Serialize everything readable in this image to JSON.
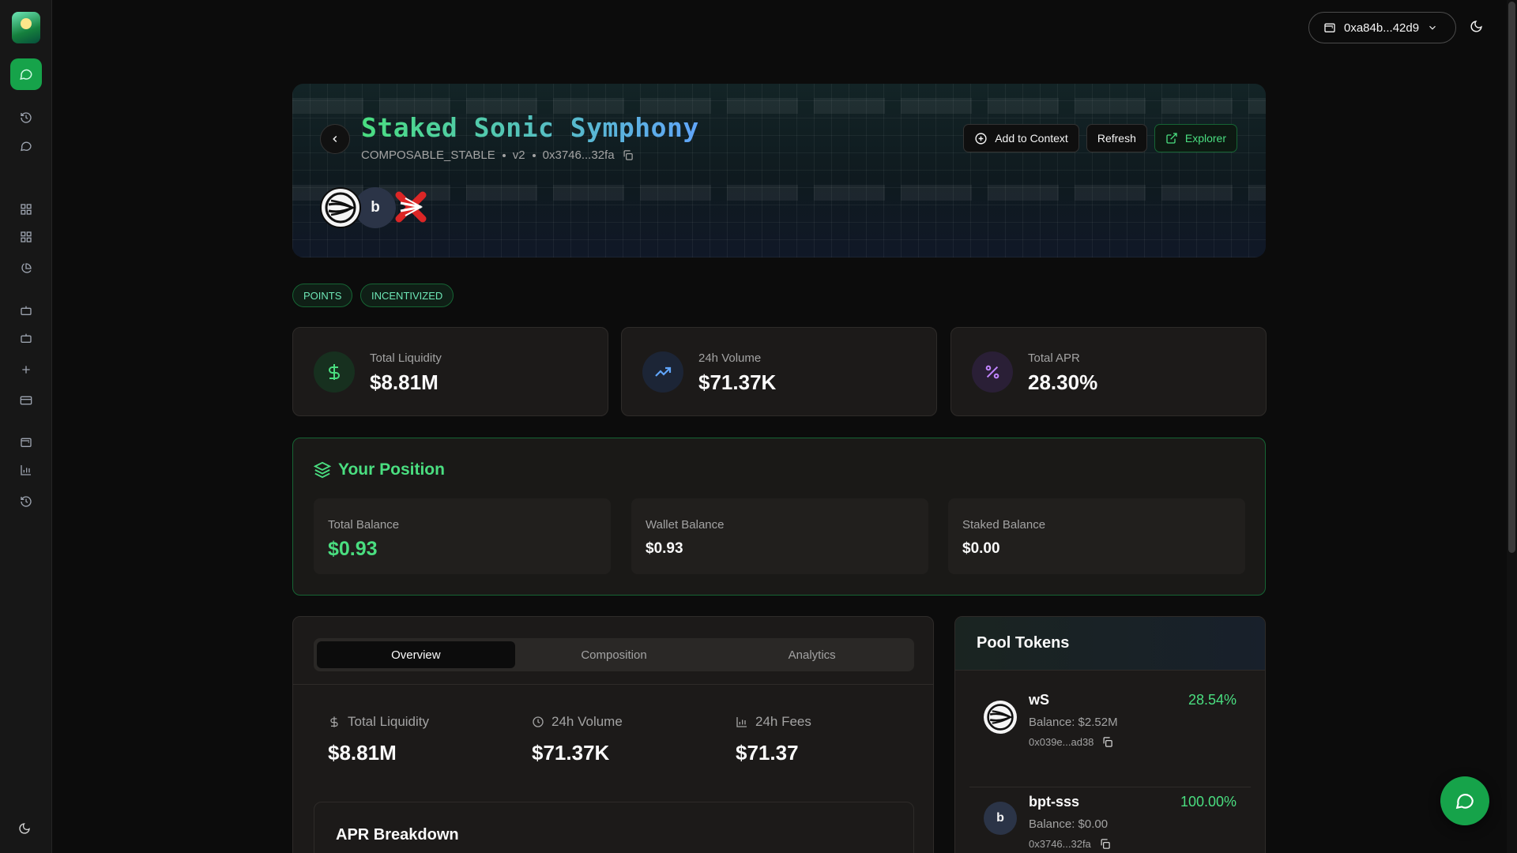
{
  "colors": {
    "accent": "#4ade80",
    "accent_dark": "#16a34a",
    "background": "#0c0c0c",
    "card": "#1c1a19",
    "blue": "#60a5fa",
    "purple": "#c084fc"
  },
  "topbar": {
    "wallet_label": "0xa84b...42d9",
    "wallet_icon": "wallet-icon",
    "theme_icon": "moon-icon"
  },
  "sidebar": {
    "items": [
      {
        "name": "history-icon"
      },
      {
        "name": "chat-icon"
      },
      {
        "name": "dashboard-icon"
      },
      {
        "name": "grid-icon"
      },
      {
        "name": "pie-chart-icon"
      },
      {
        "name": "bot-icon"
      },
      {
        "name": "bot-2-icon"
      },
      {
        "name": "plus-icon"
      },
      {
        "name": "card-icon"
      },
      {
        "name": "wallet-icon"
      },
      {
        "name": "bar-chart-icon"
      },
      {
        "name": "history-2-icon"
      },
      {
        "name": "moon-icon"
      }
    ]
  },
  "pool": {
    "title": "Staked Sonic Symphony",
    "type": "COMPOSABLE_STABLE",
    "version": "v2",
    "address": "0x3746...32fa",
    "actions": {
      "add_context": "Add to Context",
      "refresh": "Refresh",
      "explorer": "Explorer"
    },
    "tags": [
      "POINTS",
      "INCENTIVIZED"
    ],
    "token_badge_letter": "b"
  },
  "stats": [
    {
      "label": "Total Liquidity",
      "value": "$8.81M",
      "icon": "dollar-icon"
    },
    {
      "label": "24h Volume",
      "value": "$71.37K",
      "icon": "trending-up-icon"
    },
    {
      "label": "Total APR",
      "value": "28.30%",
      "icon": "percent-icon"
    }
  ],
  "position": {
    "title": "Your Position",
    "total": {
      "label": "Total Balance",
      "value": "$0.93"
    },
    "wallet": {
      "label": "Wallet Balance",
      "value": "$0.93"
    },
    "staked": {
      "label": "Staked Balance",
      "value": "$0.00"
    }
  },
  "overview": {
    "tabs": [
      "Overview",
      "Composition",
      "Analytics"
    ],
    "active_tab": "Overview",
    "liquidity": {
      "label": "Total Liquidity",
      "value": "$8.81M"
    },
    "volume": {
      "label": "24h Volume",
      "value": "$71.37K"
    },
    "fees": {
      "label": "24h Fees",
      "value": "$71.37"
    },
    "apr_title": "APR Breakdown"
  },
  "pool_tokens": {
    "title": "Pool Tokens",
    "items": [
      {
        "symbol": "wS",
        "balance": "Balance: $2.52M",
        "address": "0x039e...ad38",
        "weight": "28.54%",
        "icon_letter": ""
      },
      {
        "symbol": "bpt-sss",
        "balance": "Balance: $0.00",
        "address": "0x3746...32fa",
        "weight": "100.00%",
        "icon_letter": "b"
      }
    ]
  }
}
